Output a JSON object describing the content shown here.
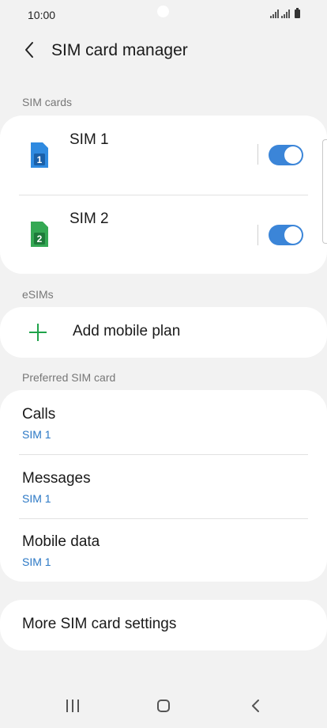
{
  "status_bar": {
    "time": "10:00"
  },
  "header": {
    "title": "SIM card manager"
  },
  "sections": {
    "sim_cards": "SIM cards",
    "esims": "eSIMs",
    "preferred": "Preferred SIM card"
  },
  "sims": [
    {
      "name": "SIM 1",
      "badge": "1",
      "color": "#2f8ae0",
      "enabled": true
    },
    {
      "name": "SIM 2",
      "badge": "2",
      "color": "#34a853",
      "enabled": true
    }
  ],
  "esim": {
    "add_label": "Add mobile plan"
  },
  "preferred": [
    {
      "title": "Calls",
      "value": "SIM 1"
    },
    {
      "title": "Messages",
      "value": "SIM 1"
    },
    {
      "title": "Mobile data",
      "value": "SIM 1"
    }
  ],
  "more": {
    "label": "More SIM card settings"
  },
  "colors": {
    "accent_blue": "#3b85d8",
    "link_blue": "#2b78c5",
    "add_green": "#1fa34a"
  }
}
